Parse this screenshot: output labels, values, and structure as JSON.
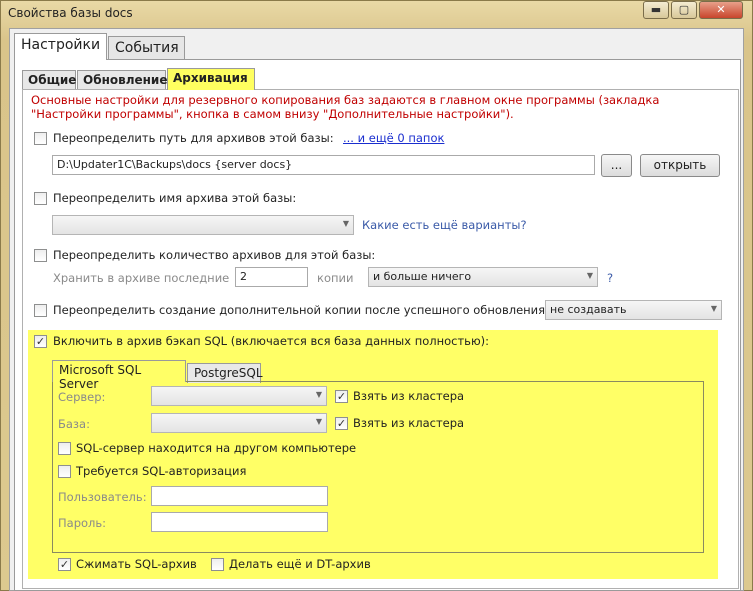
{
  "window": {
    "title": "Свойства базы docs",
    "minimize": "▬",
    "maximize": "▢",
    "close": "✕"
  },
  "tabs": [
    {
      "label": "Настройки",
      "active": true
    },
    {
      "label": "События",
      "active": false
    }
  ],
  "subtabs": [
    {
      "label": "Общие",
      "active": false
    },
    {
      "label": "Обновление",
      "active": false
    },
    {
      "label": "Архивация",
      "active": true
    }
  ],
  "info_text": "Основные настройки для резервного копирования баз задаются в главном окне программы (закладка \"Настройки программы\", кнопка в самом внизу \"Дополнительные настройки\").",
  "override_path": {
    "checked": false,
    "label": "Переопределить путь для архивов этой базы:",
    "link": "... и ещё 0 папок",
    "value": "D:\\Updater1C\\Backups\\docs {server docs}",
    "browse": "...",
    "open": "открыть"
  },
  "override_name": {
    "checked": false,
    "label": "Переопределить имя архива этой базы:",
    "combo_value": "",
    "hint": "Какие есть ещё варианты?"
  },
  "override_count": {
    "checked": false,
    "label": "Переопределить количество архивов для этой базы:",
    "keep_label": "Хранить в архиве последние",
    "keep_value": "2",
    "copies_label": "копии",
    "copies_combo": "и больше ничего",
    "help": "?"
  },
  "override_extra": {
    "checked": false,
    "label": "Переопределить создание дополнительной копии после успешного обновления:",
    "combo": "не создавать"
  },
  "sql": {
    "checked": true,
    "label": "Включить в архив бэкап SQL (включается вся база данных полностью):",
    "tabs": [
      {
        "label": "Microsoft SQL Server",
        "active": true
      },
      {
        "label": "PostgreSQL",
        "active": false
      }
    ],
    "server_label": "Сервер:",
    "server_value": "",
    "server_cluster_checked": true,
    "server_cluster_label": "Взять из кластера",
    "base_label": "База:",
    "base_value": "",
    "base_cluster_checked": true,
    "base_cluster_label": "Взять из кластера",
    "other_computer_checked": false,
    "other_computer_label": "SQL-сервер находится на другом компьютере",
    "auth_checked": false,
    "auth_label": "Требуется SQL-авторизация",
    "user_label": "Пользователь:",
    "user_value": "",
    "password_label": "Пароль:",
    "password_value": "",
    "compress_checked": true,
    "compress_label": "Сжимать SQL-архив",
    "dt_checked": false,
    "dt_label": "Делать ещё и DT-архив"
  }
}
